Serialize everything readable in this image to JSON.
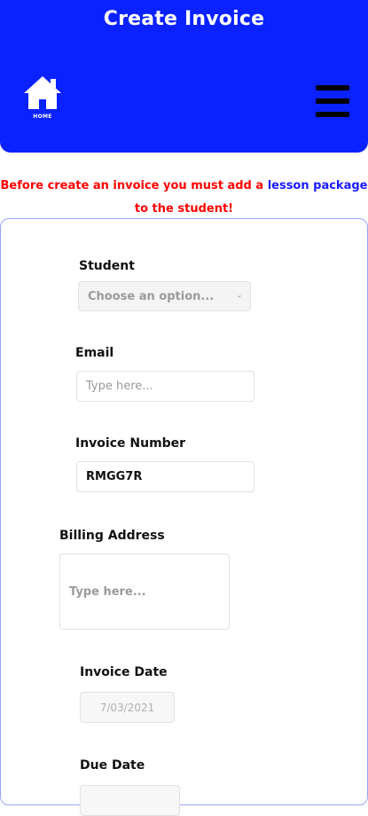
{
  "header": {
    "title": "Create Invoice",
    "home_label": "HOME"
  },
  "warning": {
    "text_before": "Before create an invoice you must add a ",
    "link_text": "lesson package",
    "text_after": " to the student!"
  },
  "form": {
    "student": {
      "label": "Student",
      "placeholder": "Choose an option..."
    },
    "email": {
      "label": "Email",
      "placeholder": "Type here..."
    },
    "invoice_number": {
      "label": "Invoice Number",
      "value": "RMGG7R"
    },
    "billing_address": {
      "label": "Billing Address",
      "placeholder": "Type here..."
    },
    "invoice_date": {
      "label": "Invoice Date",
      "value": "7/03/2021"
    },
    "due_date": {
      "label": "Due Date"
    }
  },
  "colors": {
    "header_bg": "#0a22ff",
    "warning": "#ff0000",
    "link": "#1a1aff"
  }
}
